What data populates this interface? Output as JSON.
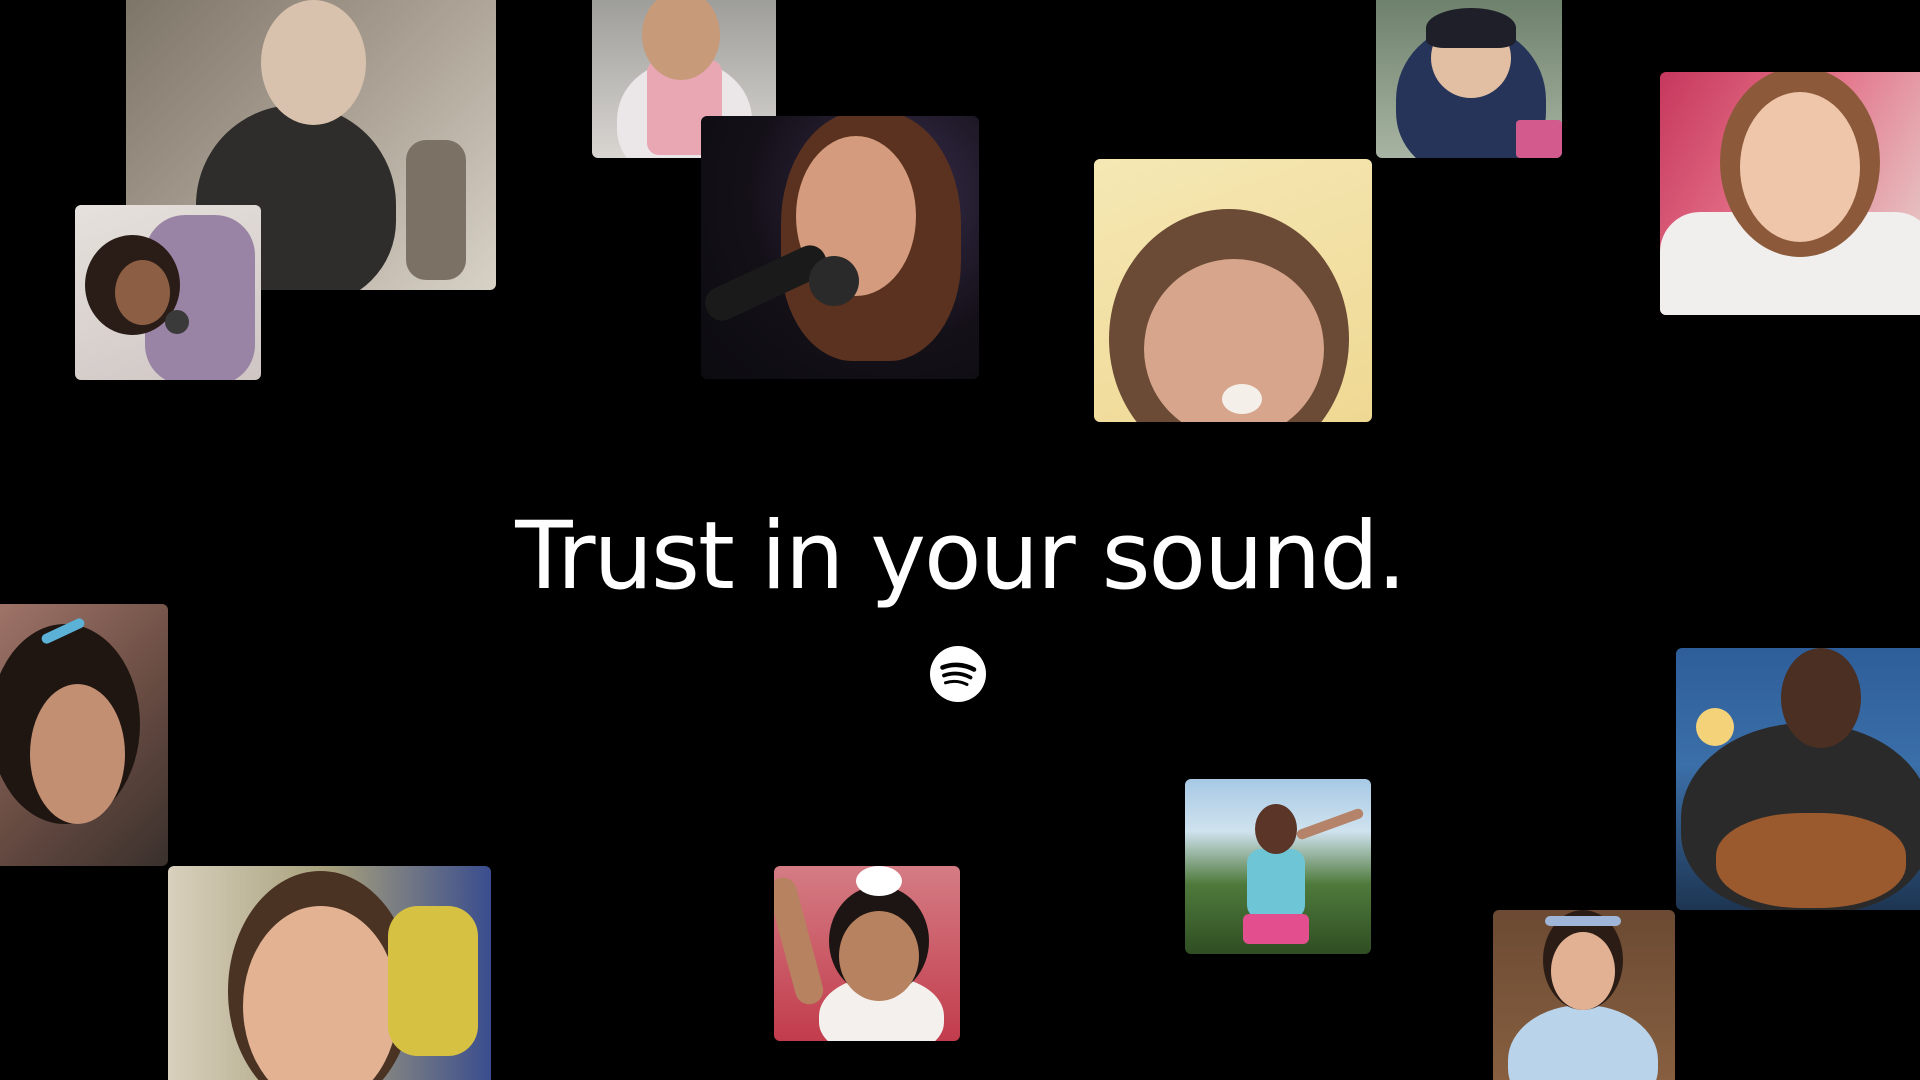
{
  "headline": "Trust in your sound.",
  "brand": {
    "logo_icon": "spotify-logo-icon",
    "background_color": "#000000",
    "text_color": "#ffffff"
  },
  "photos": [
    {
      "name": "photo-boy-singing-kitchen",
      "icon": "photo-icon"
    },
    {
      "name": "photo-girl-with-microphone",
      "icon": "photo-icon"
    },
    {
      "name": "photo-toddler-pink-apron",
      "icon": "photo-icon"
    },
    {
      "name": "photo-woman-singing-stage",
      "icon": "photo-icon"
    },
    {
      "name": "photo-child-yellow-wall",
      "icon": "photo-icon"
    },
    {
      "name": "photo-toddler-blue-jacket",
      "icon": "photo-icon"
    },
    {
      "name": "photo-girl-smiling-white-shirt",
      "icon": "photo-icon"
    },
    {
      "name": "photo-girl-headphones",
      "icon": "photo-icon"
    },
    {
      "name": "photo-boy-smiling-closeup",
      "icon": "photo-icon"
    },
    {
      "name": "photo-girl-white-bow",
      "icon": "photo-icon"
    },
    {
      "name": "photo-girl-singing-outdoors",
      "icon": "photo-icon"
    },
    {
      "name": "photo-young-man-guitar",
      "icon": "photo-icon"
    },
    {
      "name": "photo-girl-princess-dress",
      "icon": "photo-icon"
    }
  ]
}
